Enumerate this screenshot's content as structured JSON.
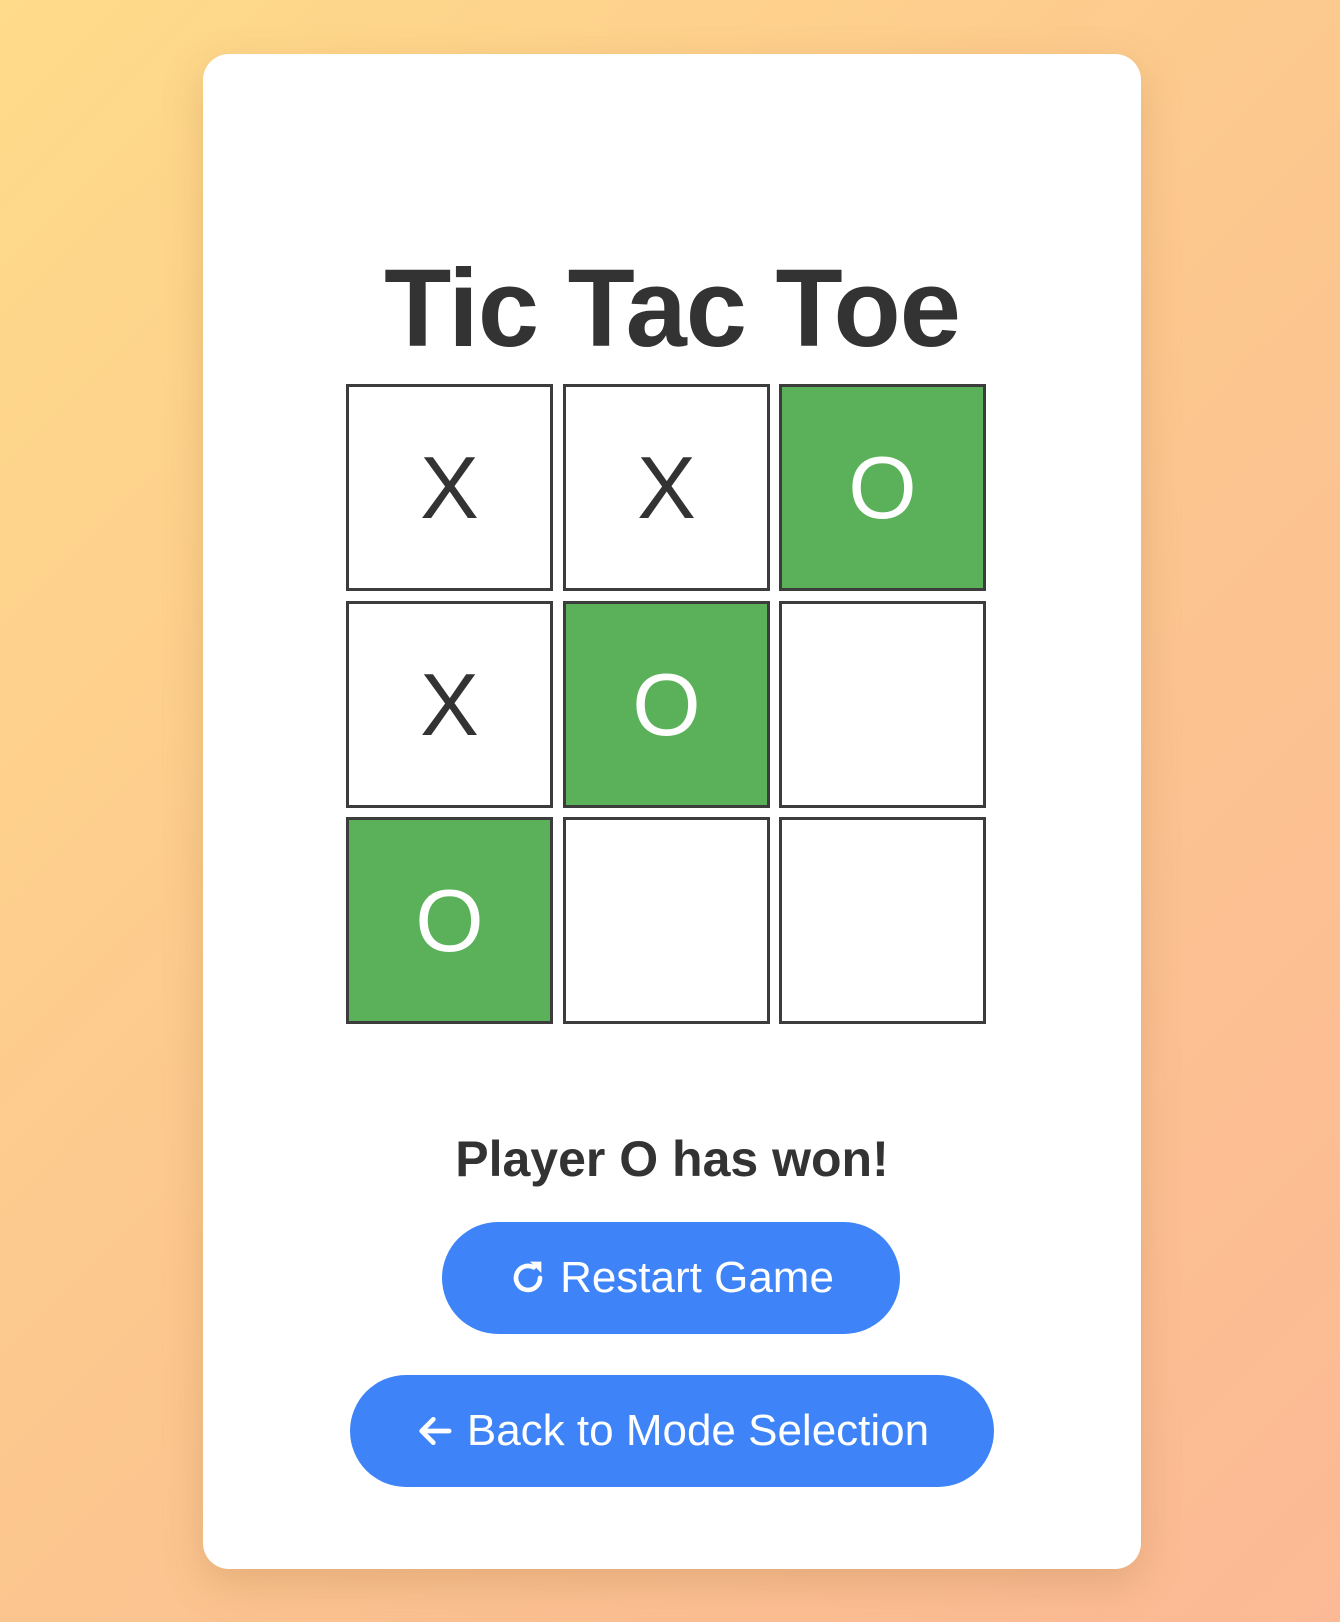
{
  "game": {
    "title": "Tic Tac Toe",
    "board": [
      {
        "value": "X",
        "winning": false
      },
      {
        "value": "X",
        "winning": false
      },
      {
        "value": "O",
        "winning": true
      },
      {
        "value": "X",
        "winning": false
      },
      {
        "value": "O",
        "winning": true
      },
      {
        "value": "",
        "winning": false
      },
      {
        "value": "O",
        "winning": true
      },
      {
        "value": "",
        "winning": false
      },
      {
        "value": "",
        "winning": false
      }
    ],
    "status": "Player O has won!",
    "winner": "O"
  },
  "buttons": {
    "restart_label": "Restart Game",
    "restart_icon": "rotate-right-icon",
    "back_label": "Back to Mode Selection",
    "back_icon": "arrow-left-icon"
  },
  "colors": {
    "win_cell": "#5bb15a",
    "button": "#3e84f8",
    "text": "#333333"
  }
}
